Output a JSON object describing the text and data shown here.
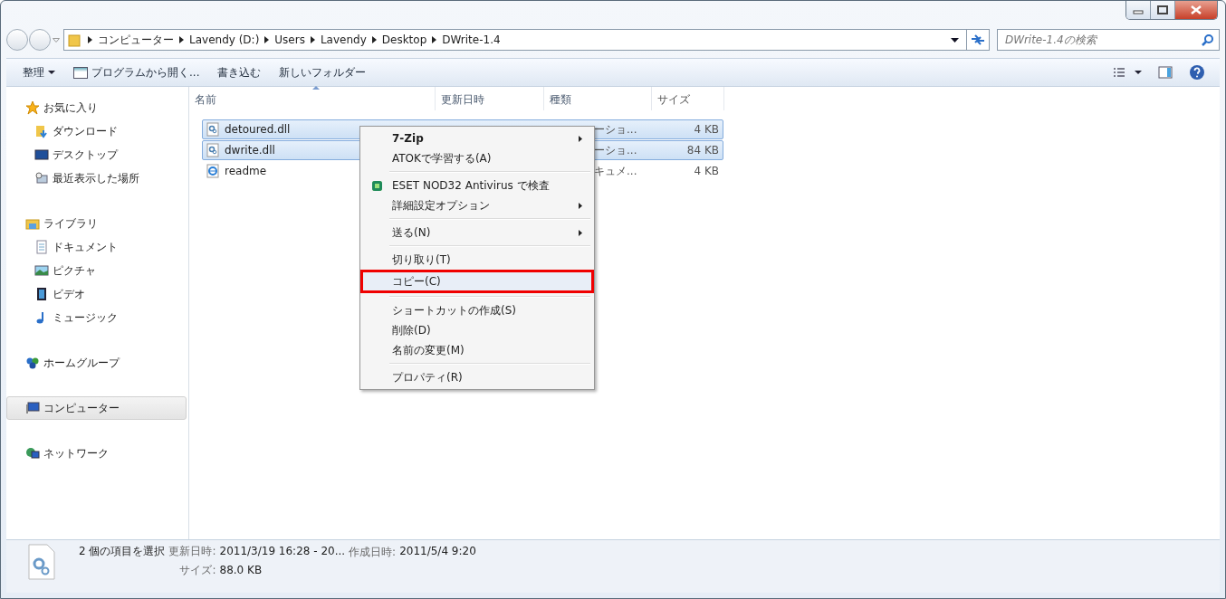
{
  "address_bar": {
    "crumbs": [
      "コンピューター",
      "Lavendy (D:)",
      "Users",
      "Lavendy",
      "Desktop",
      "DWrite-1.4"
    ]
  },
  "search": {
    "placeholder": "DWrite-1.4の検索"
  },
  "toolbar": {
    "buttons": [
      {
        "label": "整理",
        "kind": "dropdown"
      },
      {
        "label": "プログラムから開く...",
        "kind": "open-with"
      },
      {
        "label": "書き込む",
        "kind": "plain"
      },
      {
        "label": "新しいフォルダー",
        "kind": "plain"
      }
    ]
  },
  "sidebar": {
    "groups": [
      {
        "label": "お気に入り",
        "selected": false,
        "children": [
          {
            "label": "ダウンロード",
            "selected": false
          },
          {
            "label": "デスクトップ",
            "selected": false
          },
          {
            "label": "最近表示した場所",
            "selected": false
          }
        ]
      },
      {
        "label": "ライブラリ",
        "selected": false,
        "children": [
          {
            "label": "ドキュメント",
            "selected": false
          },
          {
            "label": "ピクチャ",
            "selected": false
          },
          {
            "label": "ビデオ",
            "selected": false
          },
          {
            "label": "ミュージック",
            "selected": false
          }
        ]
      },
      {
        "label": "ホームグループ",
        "selected": false
      },
      {
        "label": "コンピューター",
        "selected": true
      },
      {
        "label": "ネットワーク",
        "selected": false
      }
    ]
  },
  "table": {
    "columns": [
      {
        "label": "名前",
        "sorted": true
      },
      {
        "label": "更新日時",
        "sorted": false
      },
      {
        "label": "種類",
        "sorted": false
      },
      {
        "label": "サイズ",
        "sorted": false
      }
    ],
    "rows": [
      {
        "name": "detoured.dll",
        "type": "ーショ...",
        "size": "4 KB",
        "selected": true,
        "kind": "dll"
      },
      {
        "name": "dwrite.dll",
        "type": "ーショ...",
        "size": "84 KB",
        "selected": true,
        "kind": "dll"
      },
      {
        "name": "readme",
        "type": "キュメ...",
        "size": "4 KB",
        "selected": false,
        "kind": "html"
      }
    ]
  },
  "context_menu": {
    "items": [
      {
        "kind": "item",
        "label": "7-Zip",
        "bold": true,
        "submenu": true,
        "highlighted": false
      },
      {
        "kind": "item",
        "label": "ATOKで学習する(A)",
        "bold": false,
        "submenu": false,
        "highlighted": false
      },
      {
        "kind": "separator"
      },
      {
        "kind": "item",
        "label": "ESET NOD32 Antivirus で検査",
        "bold": false,
        "submenu": false,
        "highlighted": false,
        "icon": true
      },
      {
        "kind": "item",
        "label": "詳細設定オプション",
        "bold": false,
        "submenu": true,
        "highlighted": false
      },
      {
        "kind": "separator"
      },
      {
        "kind": "item",
        "label": "送る(N)",
        "bold": false,
        "submenu": true,
        "highlighted": false
      },
      {
        "kind": "separator"
      },
      {
        "kind": "item",
        "label": "切り取り(T)",
        "bold": false,
        "submenu": false,
        "highlighted": false
      },
      {
        "kind": "item",
        "label": "コピー(C)",
        "bold": false,
        "submenu": false,
        "highlighted": true
      },
      {
        "kind": "separator"
      },
      {
        "kind": "item",
        "label": "ショートカットの作成(S)",
        "bold": false,
        "submenu": false,
        "highlighted": false
      },
      {
        "kind": "item",
        "label": "削除(D)",
        "bold": false,
        "submenu": false,
        "highlighted": false
      },
      {
        "kind": "item",
        "label": "名前の変更(M)",
        "bold": false,
        "submenu": false,
        "highlighted": false
      },
      {
        "kind": "separator"
      },
      {
        "kind": "item",
        "label": "プロパティ(R)",
        "bold": false,
        "submenu": false,
        "highlighted": false
      }
    ]
  },
  "status_bar": {
    "summary": "2 個の項目を選択",
    "lines": [
      [
        {
          "label": "更新日時:",
          "value": "2011/3/19 16:28 - 20..."
        },
        {
          "label": "作成日時:",
          "value": "2011/5/4 9:20"
        }
      ],
      [
        {
          "label": "サイズ:",
          "value": "88.0 KB"
        }
      ]
    ]
  }
}
